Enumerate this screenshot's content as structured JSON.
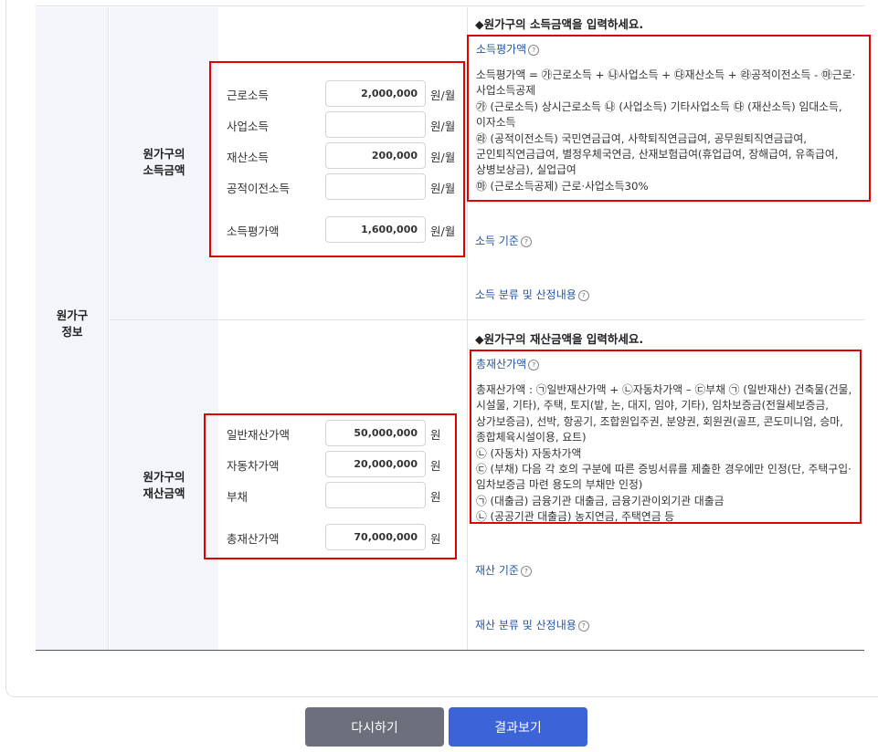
{
  "section_label": "원가구\n정보",
  "income": {
    "label": "원가구의\n소득금액",
    "fields": [
      {
        "label": "근로소득",
        "value": "2,000,000",
        "unit": "원/월"
      },
      {
        "label": "사업소득",
        "value": "",
        "unit": "원/월"
      },
      {
        "label": "재산소득",
        "value": "200,000",
        "unit": "원/월"
      },
      {
        "label": "공적이전소득",
        "value": "",
        "unit": "원/월"
      }
    ],
    "total": {
      "label": "소득평가액",
      "value": "1,600,000",
      "unit": "원/월"
    },
    "heading": "◆원가구의 소득금액을 입력하세요.",
    "desc_title": "소득평가액",
    "desc_lines": [
      "소득평가액 = ㉮근로소득 + ㉯사업소득 + ㉰재산소득 + ㉱공적이전소득 - ㉲근로·사업소득공제",
      "㉮ (근로소득) 상시근로소득 ㉯ (사업소득) 기타사업소득 ㉰ (재산소득) 임대소득, 이자소득",
      "㉱ (공적이전소득) 국민연금급여, 사학퇴직연금급여, 공무원퇴직연금급여, 군인퇴직연금급여, 별정우체국연금, 산재보험급여(휴업급여, 장해급여, 유족급여, 상병보상금), 실업급여",
      "㉲ (근로소득공제) 근로·사업소득30%"
    ],
    "link1": "소득 기준",
    "link2": "소득 분류 및 산정내용"
  },
  "asset": {
    "label": "원가구의\n재산금액",
    "fields": [
      {
        "label": "일반재산가액",
        "value": "50,000,000",
        "unit": "원"
      },
      {
        "label": "자동차가액",
        "value": "20,000,000",
        "unit": "원"
      },
      {
        "label": "부채",
        "value": "",
        "unit": "원"
      }
    ],
    "total": {
      "label": "총재산가액",
      "value": "70,000,000",
      "unit": "원"
    },
    "heading": "◆원가구의 재산금액을 입력하세요.",
    "desc_title": "총재산가액",
    "desc_lines": [
      "총재산가액 : ㉠일반재산가액 + ㉡자동차가액 – ㉢부채 ㉠ (일반재산) 건축물(건물, 시설물, 기타), 주택, 토지(밭, 논, 대지, 임야, 기타), 임차보증금(전월세보증금, 상가보증금), 선박, 항공기, 조합원입주권, 분양권, 회원권(골프, 콘도미니엄, 승마, 종합체육시설이용, 요트)",
      "㉡ (자동차) 자동차가액",
      "㉢ (부채) 다음 각 호의 구분에 따른 증빙서류를 제출한 경우에만 인정(단, 주택구입·임차보증금 마련 용도의 부채만 인정)",
      "㉠ (대출금) 금융기관 대출금, 금융기관이외기관 대출금",
      "㉡ (공공기관 대출금) 농지연금, 주택연금 등"
    ],
    "link1": "재산 기준",
    "link2": "재산 분류 및 산정내용"
  },
  "buttons": {
    "reset": "다시하기",
    "result": "결과보기"
  }
}
